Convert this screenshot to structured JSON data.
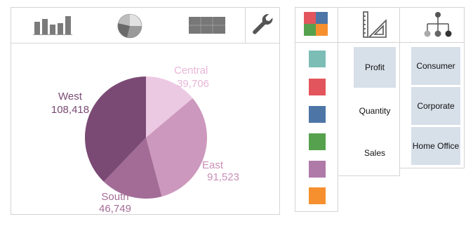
{
  "toolbar": {
    "items": [
      {
        "icon": "bar-chart-icon"
      },
      {
        "icon": "pie-chart-icon"
      },
      {
        "icon": "table-view-icon"
      },
      {
        "icon": "wrench-icon"
      }
    ]
  },
  "chart_data": {
    "type": "pie",
    "slices": [
      {
        "label": "Central",
        "value": 39706,
        "display": "39,706",
        "color": "#ecc9e3"
      },
      {
        "label": "East",
        "value": 91523,
        "display": "91,523",
        "color": "#cd98bd"
      },
      {
        "label": "South",
        "value": 46749,
        "display": "46,749",
        "color": "#a36c97"
      },
      {
        "label": "West",
        "value": 108418,
        "display": "108,418",
        "color": "#7a4a74"
      }
    ]
  },
  "color_panel": {
    "header_icon": "color-palette-icon",
    "swatches": [
      "#7cbdb6",
      "#e3555c",
      "#4d76a7",
      "#56a14d",
      "#b07aa8",
      "#f6902f"
    ]
  },
  "measure_panel": {
    "header_icon": "ruler-triangle-icon",
    "items": [
      {
        "label": "Profit",
        "selected": true
      },
      {
        "label": "Quantity",
        "selected": false
      },
      {
        "label": "Sales",
        "selected": false
      }
    ]
  },
  "segment_panel": {
    "header_icon": "hierarchy-icon",
    "items": [
      "Consumer",
      "Corporate",
      "Home Office"
    ]
  }
}
